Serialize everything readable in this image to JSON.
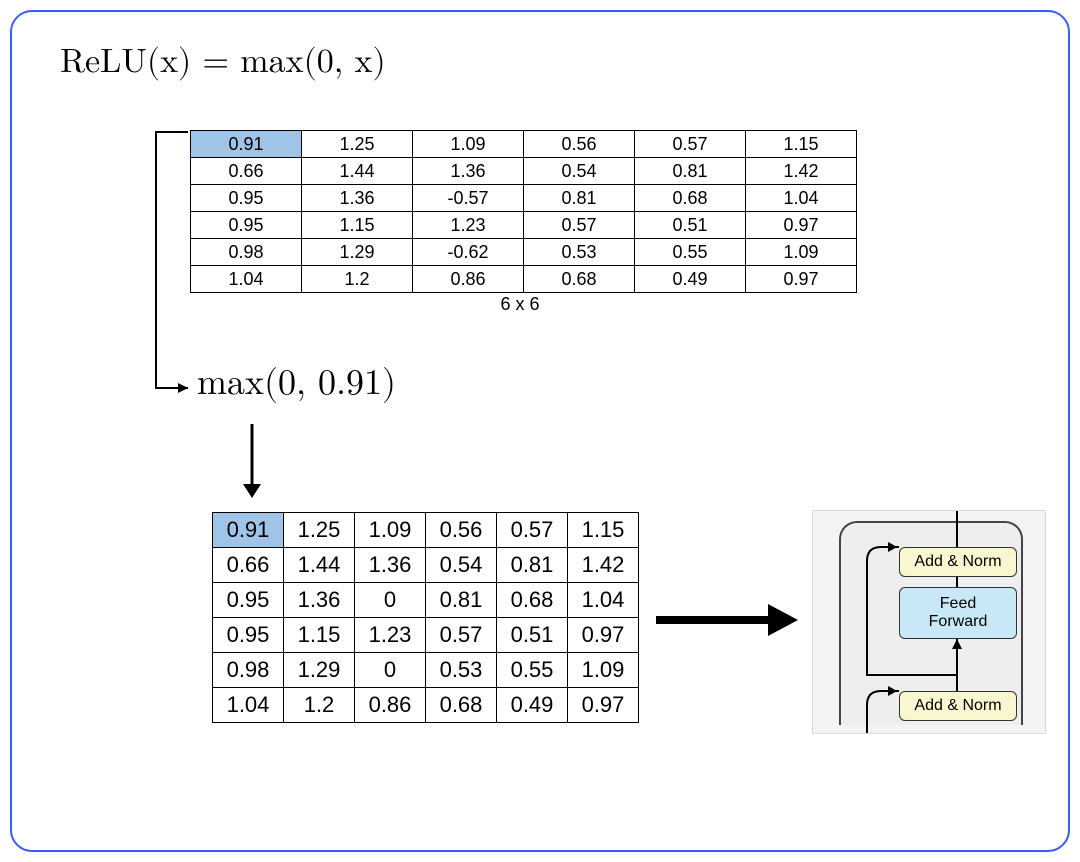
{
  "formula": "ReLU(x) = max(0, x)",
  "top_table": {
    "dims_label": "6 x 6",
    "rows": [
      [
        "0.91",
        "1.25",
        "1.09",
        "0.56",
        "0.57",
        "1.15"
      ],
      [
        "0.66",
        "1.44",
        "1.36",
        "0.54",
        "0.81",
        "1.42"
      ],
      [
        "0.95",
        "1.36",
        "-0.57",
        "0.81",
        "0.68",
        "1.04"
      ],
      [
        "0.95",
        "1.15",
        "1.23",
        "0.57",
        "0.51",
        "0.97"
      ],
      [
        "0.98",
        "1.29",
        "-0.62",
        "0.53",
        "0.55",
        "1.09"
      ],
      [
        "1.04",
        "1.2",
        "0.86",
        "0.68",
        "0.49",
        "0.97"
      ]
    ],
    "highlight": [
      0,
      0
    ]
  },
  "max_expr": "max(0, 0.91)",
  "bot_table": {
    "rows": [
      [
        "0.91",
        "1.25",
        "1.09",
        "0.56",
        "0.57",
        "1.15"
      ],
      [
        "0.66",
        "1.44",
        "1.36",
        "0.54",
        "0.81",
        "1.42"
      ],
      [
        "0.95",
        "1.36",
        "0",
        "0.81",
        "0.68",
        "1.04"
      ],
      [
        "0.95",
        "1.15",
        "1.23",
        "0.57",
        "0.51",
        "0.97"
      ],
      [
        "0.98",
        "1.29",
        "0",
        "0.53",
        "0.55",
        "1.09"
      ],
      [
        "1.04",
        "1.2",
        "0.86",
        "0.68",
        "0.49",
        "0.97"
      ]
    ],
    "highlight": [
      0,
      0
    ]
  },
  "mini_diagram": {
    "add_norm_top": "Add & Norm",
    "feed_forward": "Feed\nForward",
    "add_norm_bottom": "Add & Norm"
  }
}
